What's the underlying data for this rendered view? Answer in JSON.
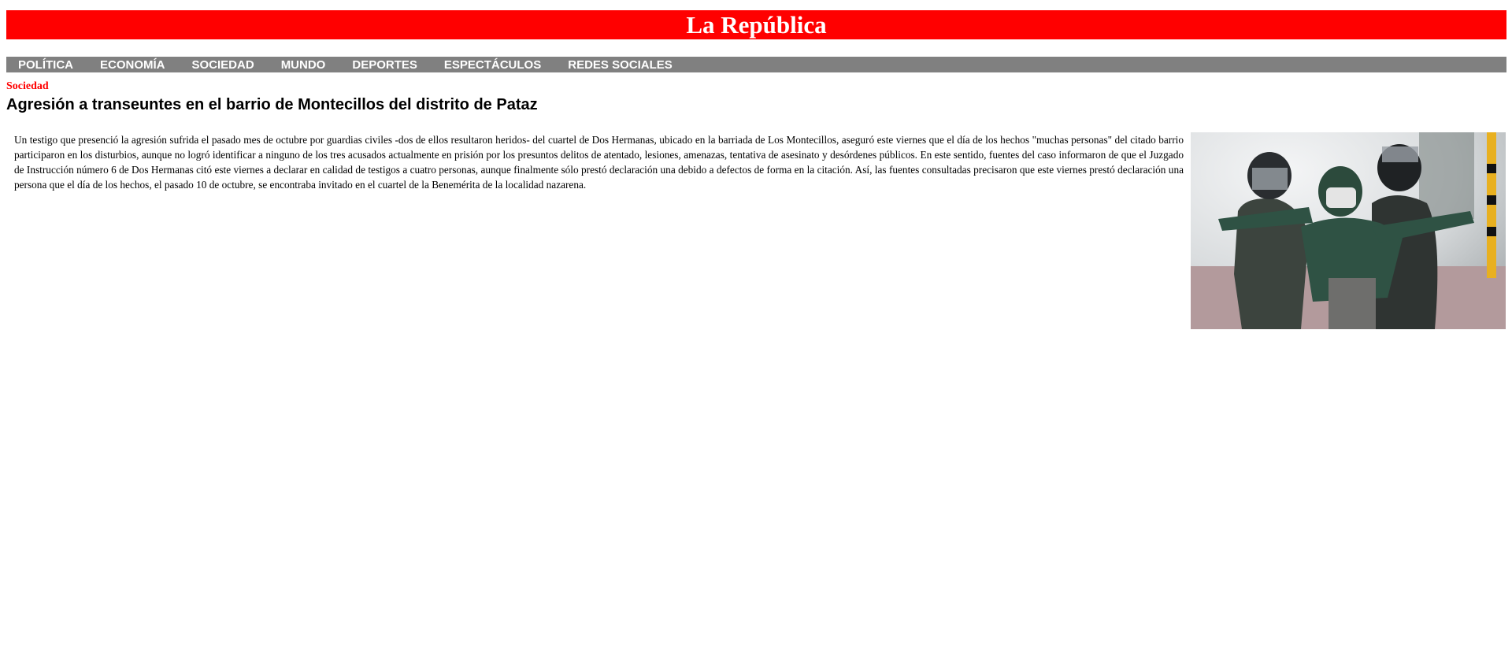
{
  "header": {
    "title": "La República",
    "brand_color": "#ff0000"
  },
  "nav": {
    "items": [
      "POLÍTICA",
      "ECONOMÍA",
      "SOCIEDAD",
      "MUNDO",
      "DEPORTES",
      "ESPECTÁCULOS",
      "REDES SOCIALES"
    ],
    "bar_color": "#808080"
  },
  "article": {
    "section": "Sociedad",
    "headline": "Agresión a transeuntes en el barrio de Montecillos del distrito de Pataz",
    "body": "Un testigo que presenció la agresión sufrida el pasado mes de octubre por guardias civiles -dos de ellos resultaron heridos- del cuartel de Dos Hermanas, ubicado en la barriada de Los Montecillos, aseguró este viernes que el día de los hechos \"muchas personas\" del citado barrio participaron en los disturbios, aunque no logró identificar a ninguno de los tres acusados actualmente en prisión por los presuntos delitos de atentado, lesiones, amenazas, tentativa de asesinato y desórdenes públicos. En este sentido, fuentes del caso informaron de que el Juzgado de Instrucción número 6 de Dos Hermanas citó este viernes a declarar en calidad de testigos a cuatro personas, aunque finalmente sólo prestó declaración una debido a defectos de forma en la citación. Así, las fuentes consultadas precisaron que este viernes prestó declaración una persona que el día de los hechos, el pasado 10 de octubre, se encontraba invitado en el cuartel de la Benemérita de la localidad nazarena.",
    "image": "riot-police-detaining-protester-photo"
  }
}
